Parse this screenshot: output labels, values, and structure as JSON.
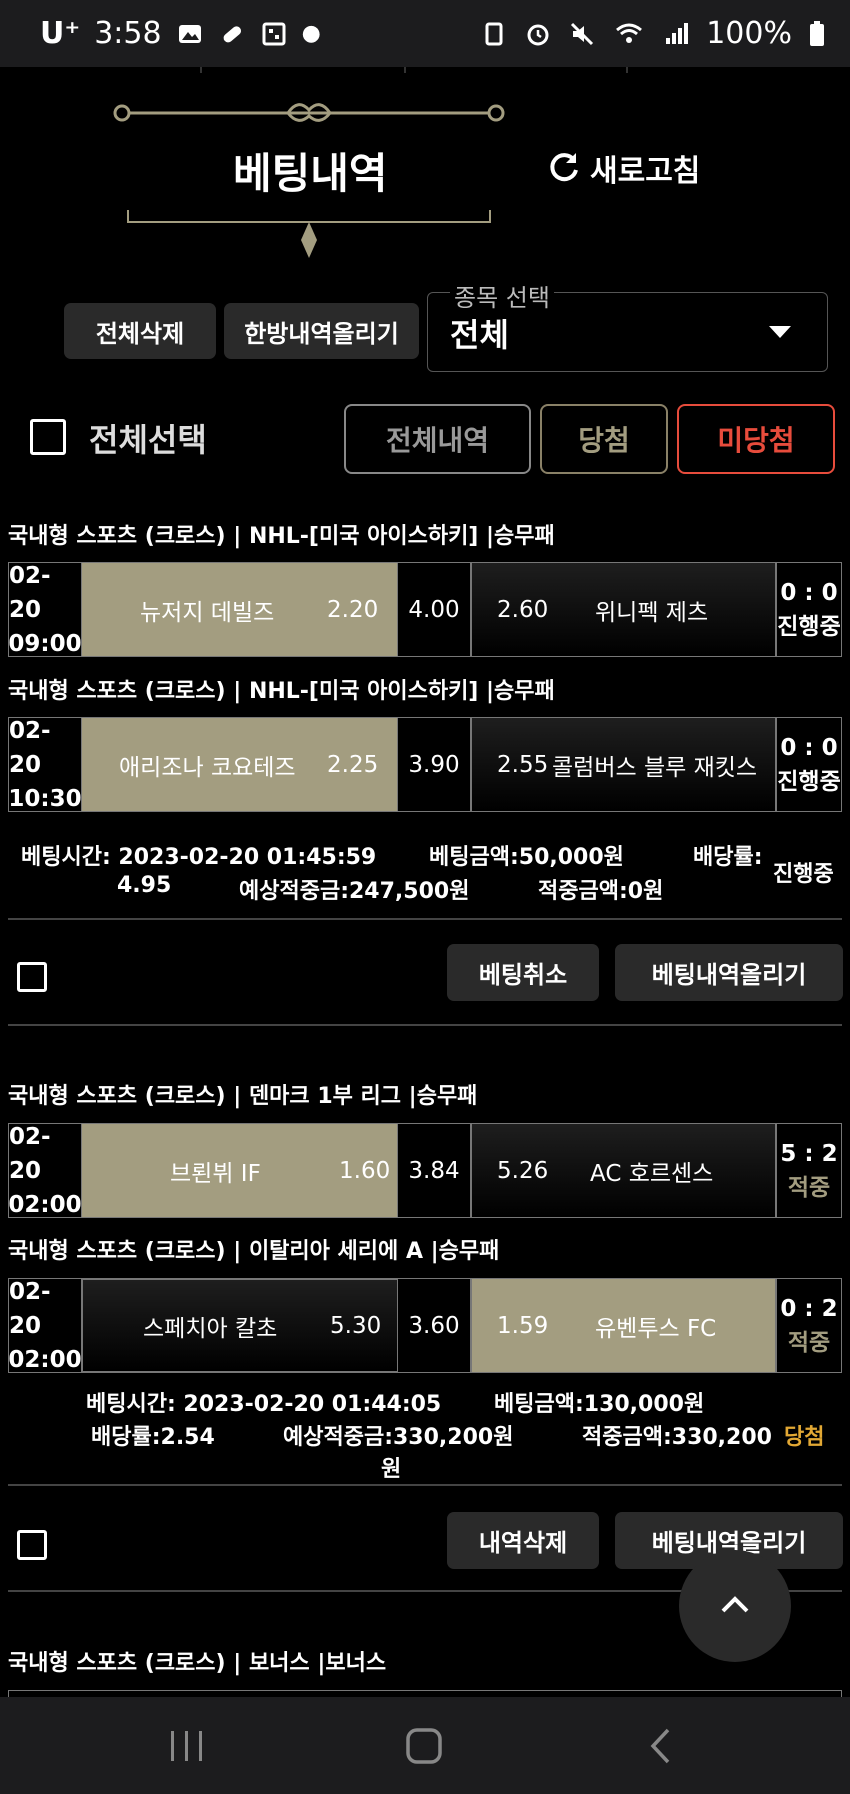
{
  "status_bar": {
    "carrier": "U⁺",
    "time": "3:58",
    "battery": "100%"
  },
  "header": {
    "title": "베팅내역",
    "refresh_label": "새로고침"
  },
  "actions": {
    "delete_all": "전체삭제",
    "upload_all": "한방내역올리기"
  },
  "sport_select": {
    "label": "종목 선택",
    "value": "전체"
  },
  "select_all_label": "전체선택",
  "filters": {
    "all": "전체내역",
    "won": "당첨",
    "not_won": "미당첨"
  },
  "bets": [
    {
      "matches": [
        {
          "league": "국내형 스포츠 (크로스) | NHL-[미국 아이스하키]  |승무패",
          "date": "02-20",
          "time": "09:00",
          "home": "뉴저지 데빌즈",
          "home_odds": "2.20",
          "draw_odds": "4.00",
          "away_odds": "2.60",
          "away": "위니펙 제츠",
          "score": "0 : 0",
          "state": "진행중",
          "selected": "home"
        },
        {
          "league": "국내형 스포츠 (크로스) | NHL-[미국 아이스하키]  |승무패",
          "date": "02-20",
          "time": "10:30",
          "home": "애리조나 코요테즈",
          "home_odds": "2.25",
          "draw_odds": "3.90",
          "away_odds": "2.55",
          "away": "콜럼버스 블루 재킷스",
          "score": "0 : 0",
          "state": "진행중",
          "selected": "home"
        }
      ],
      "bet_time": "베팅시간: 2023-02-20 01:45:59",
      "bet_amount": "베팅금액:50,000원",
      "odds_label": "배당률:",
      "odds_value": "4.95",
      "expected": "예상적중금:247,500원",
      "won_amount": "적중금액:0원",
      "result": "진행중",
      "btn_primary": "베팅취소",
      "btn_secondary": "베팅내역올리기"
    },
    {
      "matches": [
        {
          "league": "국내형 스포츠 (크로스) | 덴마크 1부 리그  |승무패",
          "date": "02-20",
          "time": "02:00",
          "home": "브뢴뷔 IF",
          "home_odds": "1.60",
          "draw_odds": "3.84",
          "away_odds": "5.26",
          "away": "AC 호르센스",
          "score": "5 : 2",
          "state": "적중",
          "selected": "home"
        },
        {
          "league": "국내형 스포츠 (크로스) | 이탈리아 세리에 A  |승무패",
          "date": "02-20",
          "time": "02:00",
          "home": "스페치아 칼초",
          "home_odds": "5.30",
          "draw_odds": "3.60",
          "away_odds": "1.59",
          "away": "유벤투스 FC",
          "score": "0 : 2",
          "state": "적중",
          "selected": "away"
        }
      ],
      "bet_time": "베팅시간: 2023-02-20 01:44:05",
      "bet_amount": "베팅금액:130,000원",
      "odds_full": "배당률:2.54",
      "expected": "예상적중금:330,200원",
      "won_amount": "적중금액:330,200",
      "won_unit": "원",
      "result": "당첨",
      "btn_primary": "내역삭제",
      "btn_secondary": "베팅내역올리기"
    }
  ],
  "bonus_league": "국내형 스포츠 (크로스) | 보너스  |보너스",
  "colors": {
    "accent_gold": "#a39d80",
    "won_gold": "#e2a834",
    "red": "#e74c3c"
  }
}
